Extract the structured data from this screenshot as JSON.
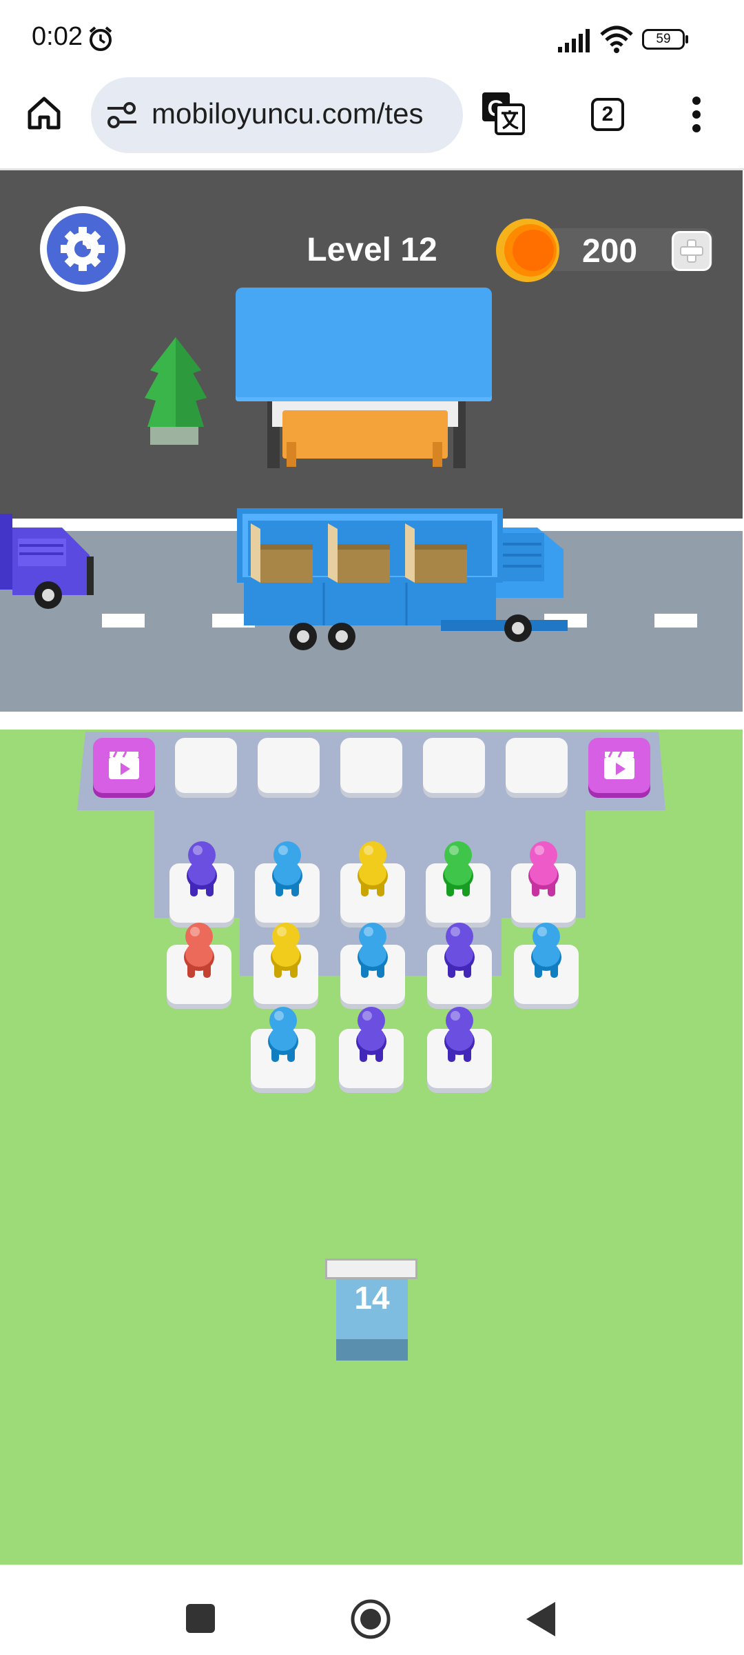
{
  "status_bar": {
    "time": "0:02",
    "battery": "59",
    "icons": [
      "alarm-icon",
      "signal-icon",
      "wifi-icon",
      "battery-icon"
    ]
  },
  "browser": {
    "url": "mobiloyuncu.com/tes",
    "tab_count": "2",
    "icons": [
      "home-icon",
      "site-settings-icon",
      "translate-icon",
      "tab-switcher-icon",
      "more-options-icon"
    ]
  },
  "game": {
    "level_label": "Level 12",
    "coins": "200",
    "tunnel_count": "14",
    "colors": {
      "purple": "#6a4fe0",
      "blue": "#3aa6ea",
      "yellow": "#f2cc1c",
      "green": "#3fc64a",
      "pink": "#ee5bc8",
      "red": "#ec6a5a",
      "ad_purple": "#d65fe3",
      "truck_blue": "#2e8fe0",
      "truck_purple": "#5b4ae0",
      "stop_roof": "#48a7f5",
      "bench": "#f09a2c"
    },
    "queue_slots": [
      {
        "type": "ad"
      },
      {
        "type": "empty"
      },
      {
        "type": "empty"
      },
      {
        "type": "empty"
      },
      {
        "type": "empty"
      },
      {
        "type": "empty"
      },
      {
        "type": "ad"
      }
    ],
    "grid_rows": [
      [
        "purple",
        "blue",
        "yellow",
        "green",
        "pink"
      ],
      [
        "red",
        "yellow",
        "blue",
        "purple",
        "blue"
      ],
      [
        "blue",
        "purple",
        "purple"
      ]
    ],
    "truck_seats": 3
  },
  "nav": {
    "icons": [
      "recents-icon",
      "home-circle-icon",
      "back-icon"
    ]
  }
}
